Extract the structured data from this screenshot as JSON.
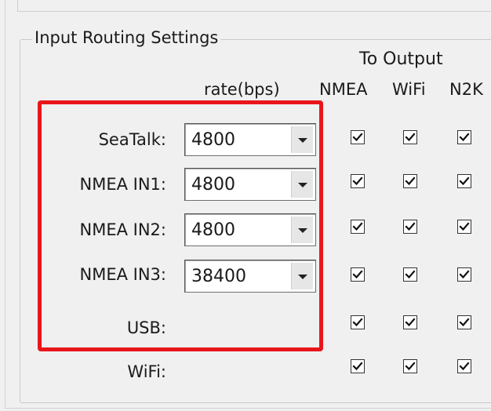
{
  "group_title": "Input Routing Settings",
  "headers": {
    "to_output": "To Output",
    "rate": "rate(bps)",
    "nmea": "NMEA",
    "wifi": "WiFi",
    "n2k": "N2K"
  },
  "rows": [
    {
      "label": "SeaTalk:",
      "rate": "4800",
      "nmea": true,
      "wifi": true,
      "n2k": true
    },
    {
      "label": "NMEA IN1:",
      "rate": "4800",
      "nmea": true,
      "wifi": true,
      "n2k": true
    },
    {
      "label": "NMEA IN2:",
      "rate": "4800",
      "nmea": true,
      "wifi": true,
      "n2k": true
    },
    {
      "label": "NMEA IN3:",
      "rate": "38400",
      "nmea": true,
      "wifi": true,
      "n2k": true
    },
    {
      "label": "USB:",
      "nmea": true,
      "wifi": true,
      "n2k": true
    },
    {
      "label": "WiFi:",
      "nmea": true,
      "wifi": true,
      "n2k": true
    }
  ],
  "colors": {
    "highlight": "#e8161a"
  }
}
